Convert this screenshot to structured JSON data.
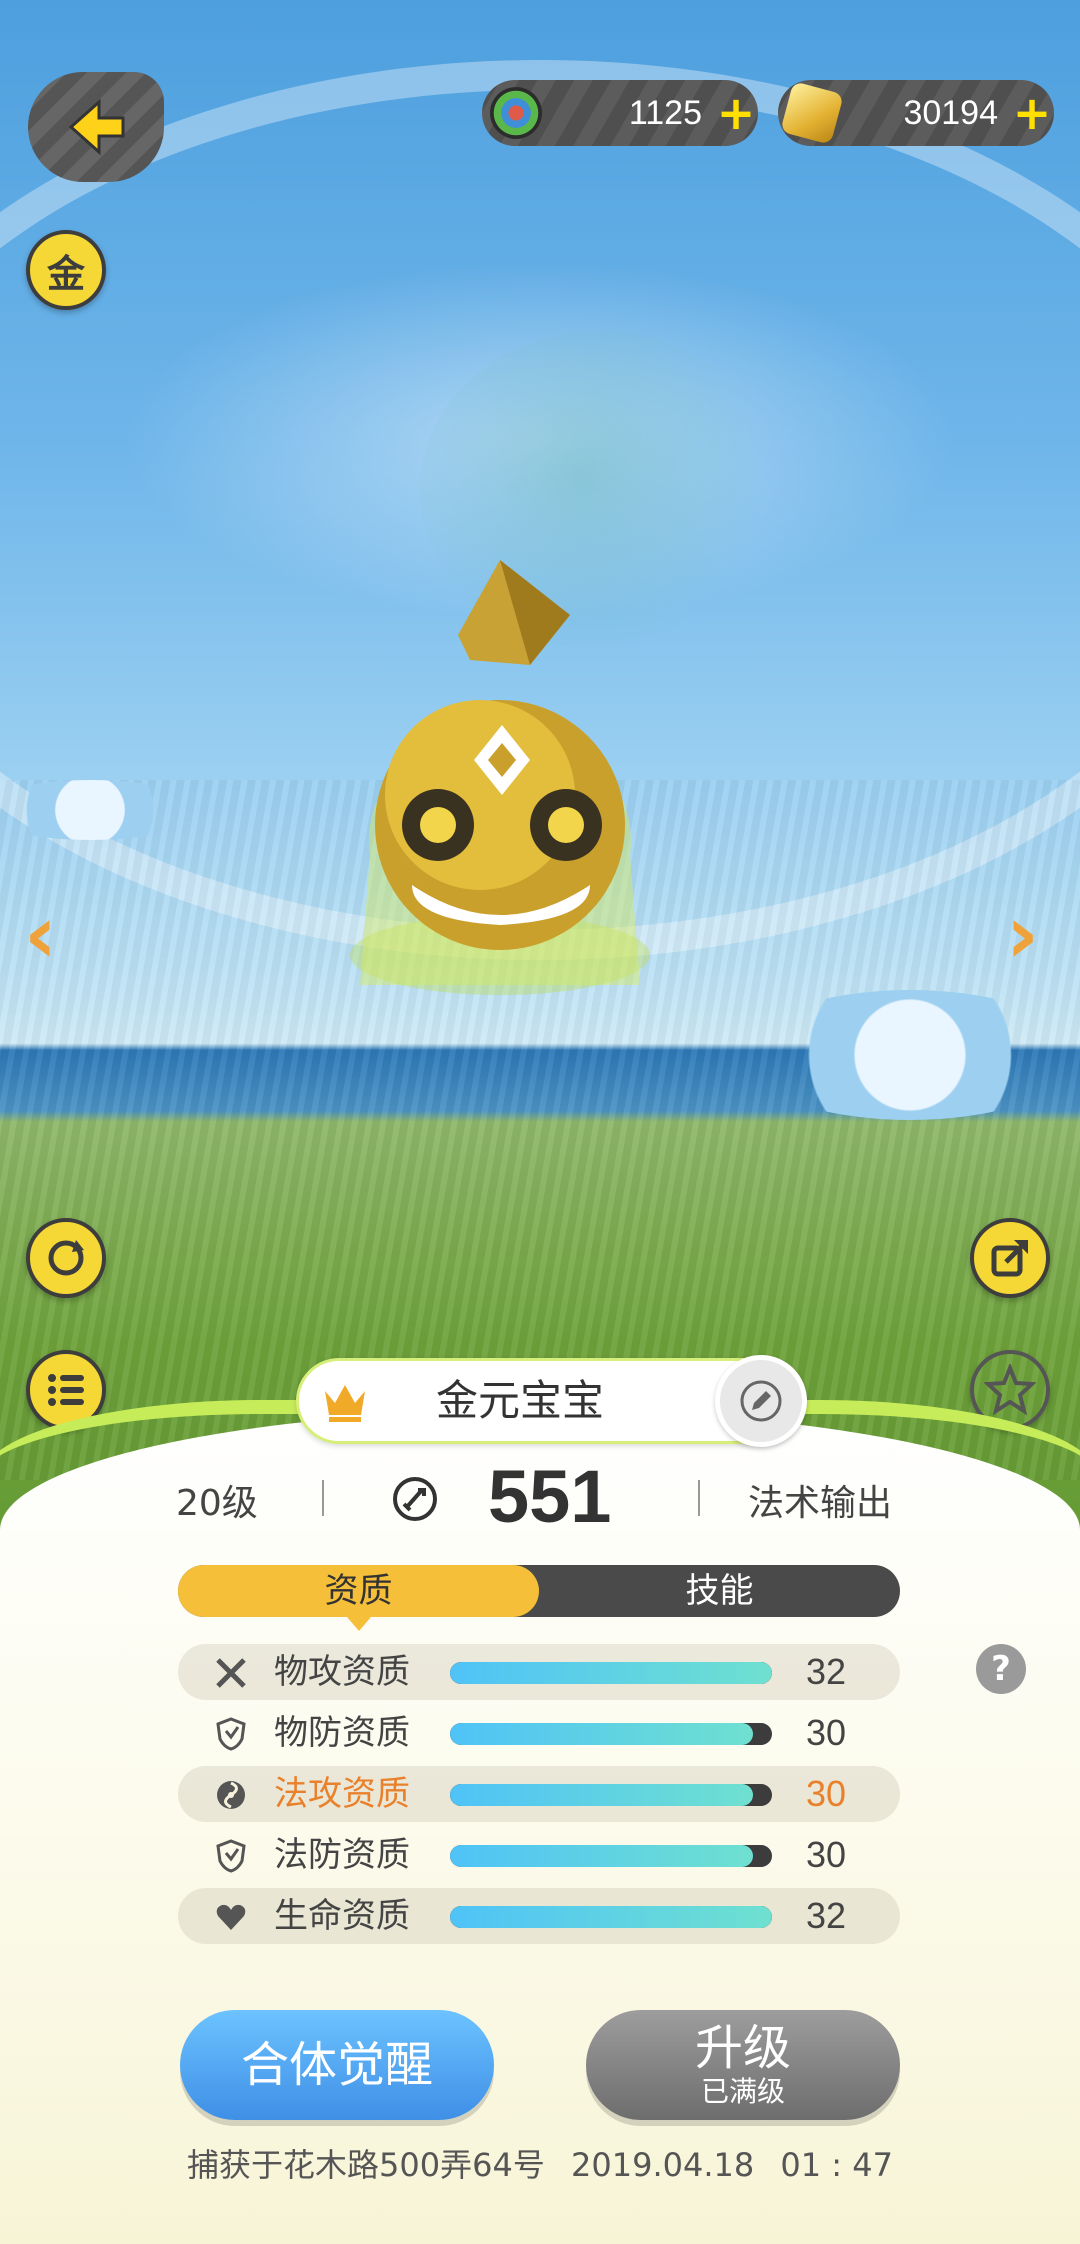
{
  "currency": {
    "gems": {
      "value": "1125",
      "plus": "+"
    },
    "coins": {
      "value": "30194",
      "plus": "+"
    }
  },
  "side_buttons": {
    "gold_badge": "金"
  },
  "pet": {
    "name": "金元宝宝",
    "level": "20级",
    "power": "551",
    "role": "法术输出"
  },
  "tabs": [
    {
      "label": "资质",
      "active": true
    },
    {
      "label": "技能",
      "active": false
    }
  ],
  "aptitudes": [
    {
      "label": "物攻资质",
      "value": "32",
      "fill": 1.0,
      "icon": "crossed-swords-icon",
      "highlight": false,
      "shaded": true
    },
    {
      "label": "物防资质",
      "value": "30",
      "fill": 0.94,
      "icon": "shield-icon",
      "highlight": false,
      "shaded": false
    },
    {
      "label": "法攻资质",
      "value": "30",
      "fill": 0.94,
      "icon": "swirl-icon",
      "highlight": true,
      "shaded": true
    },
    {
      "label": "法防资质",
      "value": "30",
      "fill": 0.94,
      "icon": "shield-icon",
      "highlight": false,
      "shaded": false
    },
    {
      "label": "生命资质",
      "value": "32",
      "fill": 1.0,
      "icon": "heart-icon",
      "highlight": false,
      "shaded": true
    }
  ],
  "help": "?",
  "buttons": {
    "awaken": "合体觉醒",
    "upgrade": "升级",
    "upgrade_sub": "已满级"
  },
  "footer": {
    "location": "捕获于花木路500弄64号",
    "date": "2019.04.18",
    "time": "01 : 47"
  },
  "colors": {
    "accent_yellow": "#f5bf3a",
    "highlight_orange": "#e9802b",
    "bar_fill": "#4fc3f7",
    "awaken_blue": "#3f8fe6"
  }
}
